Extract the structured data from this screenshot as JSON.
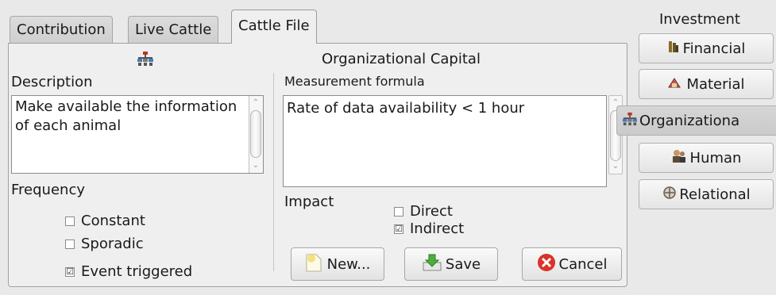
{
  "tabs": [
    {
      "label": "Contribution"
    },
    {
      "label": "Live Cattle"
    },
    {
      "label": "Cattle File"
    }
  ],
  "panel": {
    "title": "Organizational Capital",
    "description_label": "Description",
    "description_value": "Make available the information of each animal",
    "formula_label": "Measurement formula",
    "formula_value": "Rate of data availability < 1 hour",
    "frequency_label": "Frequency",
    "frequency_options": [
      {
        "label": "Constant",
        "checked": false
      },
      {
        "label": "Sporadic",
        "checked": false
      },
      {
        "label": "Event triggered",
        "checked": true
      }
    ],
    "impact_label": "Impact",
    "impact_options": [
      {
        "label": "Direct",
        "checked": false
      },
      {
        "label": "Indirect",
        "checked": true
      }
    ],
    "check_mark": "☑",
    "buttons": {
      "new": "New...",
      "save": "Save",
      "cancel": "Cancel"
    }
  },
  "investment": {
    "title": "Investment",
    "items": [
      {
        "label": "Financial",
        "icon": "financial-icon"
      },
      {
        "label": "Material",
        "icon": "material-icon"
      },
      {
        "label": "Organizationa",
        "icon": "organizational-icon",
        "active": true
      },
      {
        "label": "Human",
        "icon": "human-icon"
      },
      {
        "label": "Relational",
        "icon": "relational-icon"
      }
    ]
  },
  "colors": {
    "cancel_red": "#d9332b",
    "save_green": "#4caf3c",
    "new_yellow": "#f2dc6b",
    "org_icon_red": "#b8332a"
  }
}
